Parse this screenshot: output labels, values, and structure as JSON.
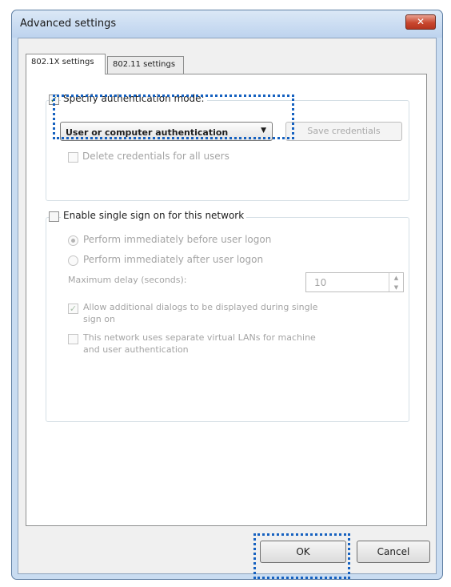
{
  "window": {
    "title": "Advanced settings",
    "close_glyph": "✕"
  },
  "tabs": [
    {
      "label": "802.1X settings",
      "active": true
    },
    {
      "label": "802.11 settings",
      "active": false
    }
  ],
  "auth_group": {
    "specify_mode_label": "Specify authentication mode:",
    "specify_mode_checked": true,
    "mode_select_value": "User or computer authentication",
    "save_credentials_label": "Save credentials",
    "delete_credentials_label": "Delete credentials for all users",
    "delete_credentials_checked": false
  },
  "sso_group": {
    "enable_label": "Enable single sign on for this network",
    "enable_checked": false,
    "before_logon_label": "Perform immediately before user logon",
    "after_logon_label": "Perform immediately after user logon",
    "max_delay_label": "Maximum delay (seconds):",
    "max_delay_value": "10",
    "allow_dialogs_line1": "Allow additional dialogs to be displayed during single",
    "allow_dialogs_line2": "sign on",
    "allow_dialogs_checked": true,
    "separate_vlans_line1": "This network uses separate virtual LANs for machine",
    "separate_vlans_line2": "and user authentication",
    "separate_vlans_checked": false
  },
  "buttons": {
    "ok": "OK",
    "cancel": "Cancel"
  },
  "checkmark_glyph": "✓",
  "dropdown_glyph": "▼",
  "spin_up_glyph": "▲",
  "spin_down_glyph": "▼",
  "colors": {
    "highlight": "#1561c0",
    "window_frame": "#c9dcf1",
    "close_button": "#c9482f"
  }
}
